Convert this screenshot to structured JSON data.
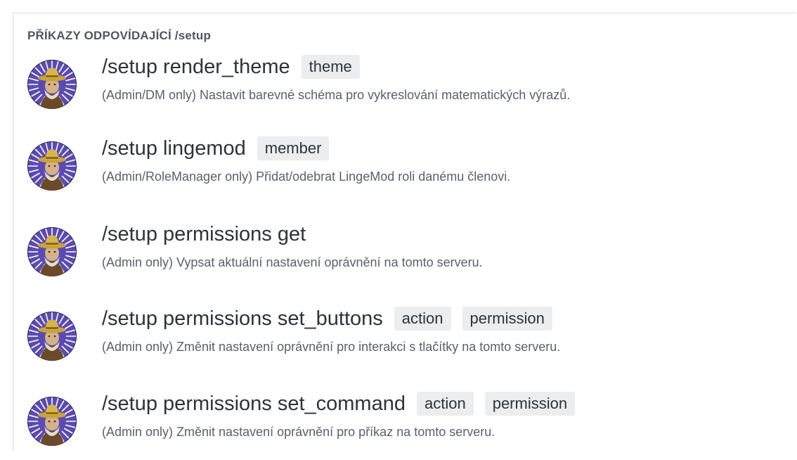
{
  "header": "PŘÍKAZY ODPOVÍDAJÍCÍ /setup",
  "commands": [
    {
      "name": "/setup render_theme",
      "options": [
        "theme"
      ],
      "description": "(Admin/DM only) Nastavit barevné schéma pro vykreslování matematických výrazů."
    },
    {
      "name": "/setup lingemod",
      "options": [
        "member"
      ],
      "description": "(Admin/RoleManager only) Přidat/odebrat LingeMod roli danému členovi."
    },
    {
      "name": "/setup permissions get",
      "options": [],
      "description": "(Admin only) Vypsat aktuální nastavení oprávnění na tomto serveru."
    },
    {
      "name": "/setup permissions set_buttons",
      "options": [
        "action",
        "permission"
      ],
      "description": "(Admin only) Změnit nastavení oprávnění pro interakci s tlačítky na tomto serveru."
    },
    {
      "name": "/setup permissions set_command",
      "options": [
        "action",
        "permission"
      ],
      "description": "(Admin only) Změnit nastavení oprávnění pro příkaz na tomto serveru."
    }
  ],
  "colors": {
    "option_bg": "#ebedef",
    "text_primary": "#2e3338",
    "text_secondary": "#5c6069",
    "avatar_ring": "#5b4bb0"
  },
  "icons": {
    "avatar": "bot-avatar-icon"
  }
}
